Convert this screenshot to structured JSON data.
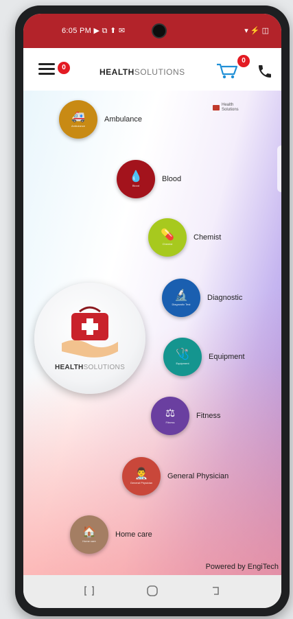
{
  "status_bar": {
    "time": "6:05 PM",
    "extras": "▶ ⧉ ⬆ ✉",
    "system": "▾ ⚡ ◫"
  },
  "app_bar": {
    "menu_badge": "0",
    "brand_bold": "HEALTH",
    "brand_light": "SOLUTIONS",
    "cart_badge": "0"
  },
  "partner_logo": {
    "line1": "Health",
    "line2": "Solutions"
  },
  "hub": {
    "brand_bold": "HEALTH",
    "brand_light": "SOLUTIONS"
  },
  "services": [
    {
      "label": "Ambulance",
      "mini": "Ambulance",
      "glyph": "🚑",
      "color": "#c88a14"
    },
    {
      "label": "Blood",
      "mini": "Blood",
      "glyph": "💧",
      "color": "#a3131c"
    },
    {
      "label": "Chemist",
      "mini": "Chemist",
      "glyph": "💊",
      "color": "#a7c91e"
    },
    {
      "label": "Diagnostic",
      "mini": "Diagnostic Test",
      "glyph": "🔬",
      "color": "#1a5fb0"
    },
    {
      "label": "Equipment",
      "mini": "Equipment",
      "glyph": "🩺",
      "color": "#14958f"
    },
    {
      "label": "Fitness",
      "mini": "Fitness",
      "glyph": "⚖",
      "color": "#6a3fa0"
    },
    {
      "label": "General Physician",
      "mini": "General Physician",
      "glyph": "👨‍⚕️",
      "color": "#c9473a"
    },
    {
      "label": "Home care",
      "mini": "Home care",
      "glyph": "🏠",
      "color": "#a47e63"
    }
  ],
  "footer": {
    "powered_by": "Powered by EngiTech"
  },
  "colors": {
    "primary": "#b3232a",
    "badge": "#e31b23",
    "cart": "#1f8fd6"
  }
}
